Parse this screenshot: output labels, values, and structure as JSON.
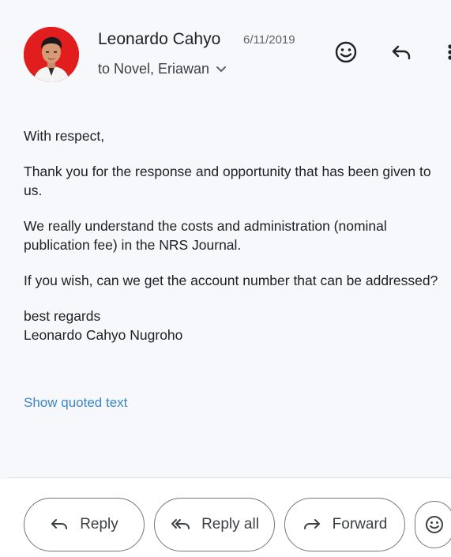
{
  "header": {
    "sender_name": "Leonardo Cahyo",
    "date": "6/11/2019",
    "recipients": "to Novel, Eriawan"
  },
  "icons": {
    "emoji": "smiley-icon",
    "reply": "reply-arrow-icon",
    "more": "more-vertical-icon",
    "recipients_toggle": "chevron-down-icon"
  },
  "message": {
    "greeting": "With respect,",
    "para1": "Thank you for the response and opportunity that has been given to us.",
    "para2": "We really understand the costs and administration (nominal publication fee) in the NRS Journal.",
    "para3": "If you wish, can we get the account number that can be addressed?",
    "closing": "best regards",
    "signature": "Leonardo Cahyo Nugroho",
    "show_quoted": "Show quoted text"
  },
  "actions": {
    "reply_label": "Reply",
    "reply_all_label": "Reply all",
    "forward_label": "Forward"
  },
  "colors": {
    "avatar_bg": "#e21d1d",
    "link": "#3b86c9"
  }
}
